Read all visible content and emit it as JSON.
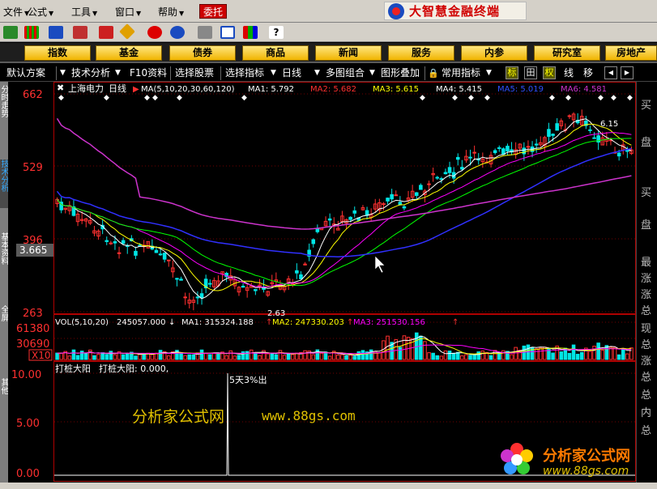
{
  "menu": {
    "items": [
      "文件",
      "公式",
      "工具",
      "窗口",
      "帮助"
    ],
    "trade": "委托",
    "brand": "大智慧金融终端"
  },
  "categories": [
    "指数",
    "基金",
    "债券",
    "商品",
    "新闻",
    "服务",
    "内参",
    "研究室",
    "房地产"
  ],
  "controls": {
    "default_scheme": "默认方案",
    "tech_analysis": "技术分析",
    "f10": "F10资料",
    "select_stock": "选择股票",
    "select_indicator": "选择指标",
    "period": "日线",
    "multi_chart": "多图组合",
    "overlay": "图形叠加",
    "common_indicator": "常用指标",
    "sq_biao": "标",
    "sq_plus": "田",
    "sq_quan": "权",
    "line": "线",
    "move": "移"
  },
  "left_tabs": [
    "分时走势",
    "技术分析",
    "基本资料",
    "全屏",
    "其他"
  ],
  "right_tabs": [
    "买",
    "盘",
    "买",
    "盘",
    "最",
    "涨",
    "涨",
    "总",
    "现",
    "总",
    "涨",
    "总",
    "总",
    "内",
    "总"
  ],
  "price_panel": {
    "stock_name": "上海电力",
    "period_label": "日线",
    "ma_label": "MA(5,10,20,30,60,120)",
    "ma1": "MA1: 5.792",
    "ma2": "MA2: 5.682",
    "ma3": "MA3: 5.615",
    "ma4": "MA4: 5.415",
    "ma5": "MA5: 5.019",
    "ma6": "MA6: 4.581",
    "y_ticks": [
      "662",
      "529",
      "396",
      "263"
    ],
    "cursor_value": "3.665",
    "low_label": "2.63",
    "high_label": "6.15"
  },
  "volume_panel": {
    "label": "VOL(5,10,20)",
    "vol_value": "245057.000",
    "ma1": "MA1: 315324.188",
    "ma2": "MA2: 247330.203",
    "ma3": "MA3: 251530.156",
    "y_ticks": [
      "61380",
      "30690"
    ],
    "unit": "X10"
  },
  "indicator_panel": {
    "name": "打桩大阳",
    "value_text": "打桩大阳: 0.000,",
    "y_ticks": [
      "10.00",
      "5.00",
      "0.00"
    ],
    "signal_text": "5天3%出"
  },
  "watermark": {
    "cn": "分析家公式网",
    "url": "www.88gs.com"
  },
  "logo": {
    "cn": "分析家公式网",
    "url": "www.88gs.com"
  },
  "colors": {
    "up": "#ff3030",
    "down": "#00e5e5",
    "ma1": "#ffffff",
    "ma2": "#ffff00",
    "ma3": "#ff00ff",
    "ma4": "#00ff00",
    "ma5": "#3030ff",
    "ma6": "#cc33cc",
    "axis": "#b00000",
    "brand": "#d00000"
  }
}
